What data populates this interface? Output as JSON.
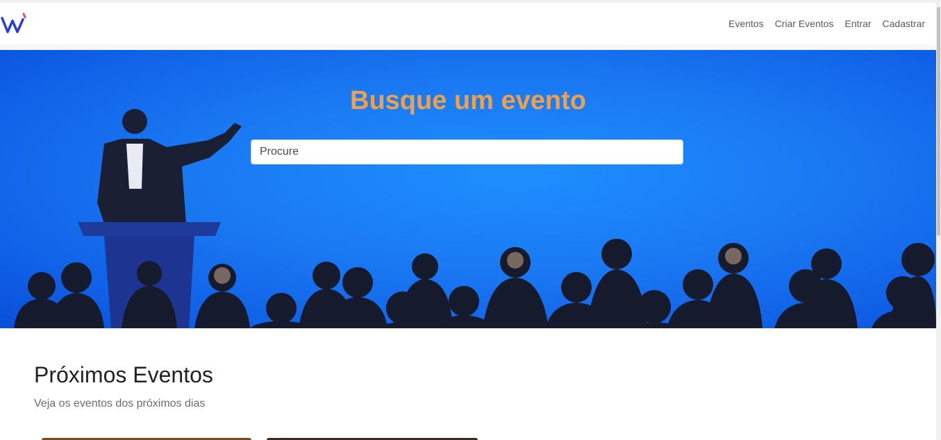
{
  "navbar": {
    "logo_icon": "w-logo-icon",
    "links": [
      "Eventos",
      "Criar Eventos",
      "Entrar",
      "Cadastrar"
    ]
  },
  "hero": {
    "title": "Busque um evento",
    "search_placeholder": "Procure",
    "background_image": "speaker-at-podium-audience-silhouettes",
    "colors": {
      "title": "#f0a048",
      "background": "#1a78f2"
    }
  },
  "events_section": {
    "title": "Próximos Eventos",
    "subtitle": "Veja os eventos dos próximos dias"
  }
}
